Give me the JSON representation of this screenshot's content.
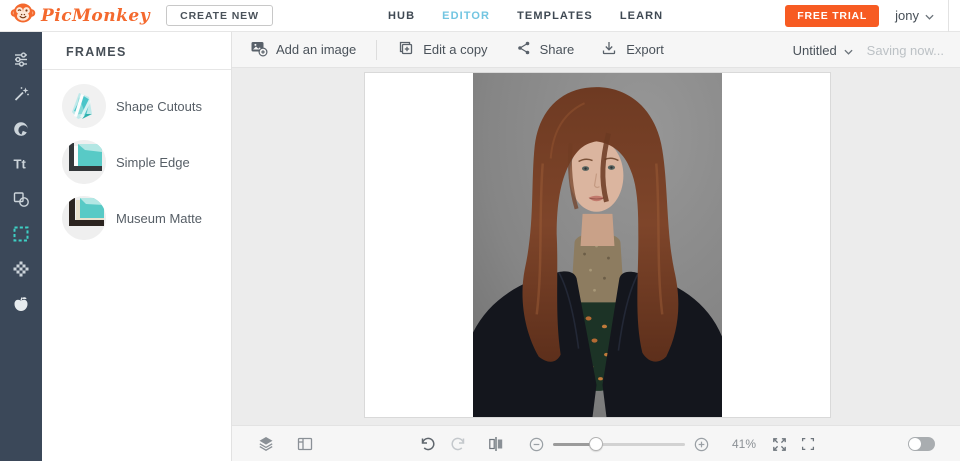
{
  "topbar": {
    "logo": "PicMonkey",
    "create_new": "CREATE NEW",
    "nav": [
      {
        "label": "HUB",
        "active": false
      },
      {
        "label": "EDITOR",
        "active": true
      },
      {
        "label": "TEMPLATES",
        "active": false
      },
      {
        "label": "LEARN",
        "active": false
      }
    ],
    "free_trial": "FREE TRIAL",
    "username": "jony"
  },
  "rail": {
    "tools": [
      "adjustments",
      "effects",
      "touch-up",
      "text",
      "graphics",
      "frames",
      "textures",
      "themes"
    ],
    "active_tool": "frames",
    "text_tool_glyph": "Tt"
  },
  "panel": {
    "title": "FRAMES",
    "items": [
      {
        "label": "Shape Cutouts"
      },
      {
        "label": "Simple Edge"
      },
      {
        "label": "Museum Matte"
      }
    ]
  },
  "toolbar": {
    "add_image": "Add an image",
    "edit_copy": "Edit a copy",
    "share": "Share",
    "export": "Export",
    "doc_title": "Untitled",
    "saving_status": "Saving now..."
  },
  "statusbar": {
    "zoom_level": "41%"
  },
  "colors": {
    "brand_orange": "#f4692e",
    "trial_button_orange": "#f75b22",
    "accent_teal": "#3ecfc4",
    "nav_active_blue": "#72c5e1",
    "rail_bg": "#3b4859"
  }
}
